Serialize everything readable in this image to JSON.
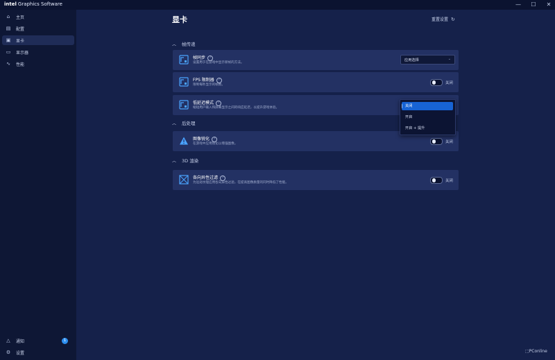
{
  "app": {
    "brand": "intel",
    "title": "Graphics Software",
    "window_controls": {
      "minimize": "—",
      "maximize": "☐",
      "close": "✕"
    }
  },
  "sidebar": {
    "items": [
      {
        "label": "主页",
        "icon": "home-icon"
      },
      {
        "label": "配置",
        "icon": "config-icon"
      },
      {
        "label": "显卡",
        "icon": "gpu-icon",
        "active": true
      },
      {
        "label": "显示器",
        "icon": "monitor-icon"
      },
      {
        "label": "性能",
        "icon": "performance-icon"
      }
    ],
    "bottom": [
      {
        "label": "通知",
        "icon": "bell-icon",
        "badge": "1"
      },
      {
        "label": "设置",
        "icon": "gear-icon"
      }
    ]
  },
  "page": {
    "title": "显卡",
    "reset_label": "重置设置"
  },
  "sections": [
    {
      "title": "帧传递",
      "cards": [
        {
          "title": "帧同步",
          "desc": "设置用于在游戏中显示新帧的方法。",
          "control": "select",
          "value": "应用选择"
        },
        {
          "title": "FPS 限制器",
          "desc": "限制每秒显示的帧数。",
          "control": "toggle",
          "value": "关闭"
        },
        {
          "title": "低延迟模式",
          "desc": "缩短用户输入和屏幕显示之间的响应延迟，以提升游戏体验。",
          "control": "dropdown",
          "options": [
            "关闭",
            "开启",
            "开启 + 提升"
          ],
          "selected": "关闭"
        }
      ]
    },
    {
      "title": "后处理",
      "cards": [
        {
          "title": "图像锐化",
          "desc": "在游戏中应用锐化以增强图像。",
          "control": "toggle",
          "value": "关闭"
        }
      ]
    },
    {
      "title": "3D 渲染",
      "cards": [
        {
          "title": "各向异性过滤",
          "desc": "为远处纹理应用各向异性过滤，在提高图像质量的同时降低了性能。",
          "control": "toggle",
          "value": "关闭"
        }
      ]
    }
  ],
  "watermark": "PConline",
  "colors": {
    "accent": "#1763d4",
    "card": "#233163",
    "background": "#15214a",
    "sidebar": "#0e1735"
  }
}
